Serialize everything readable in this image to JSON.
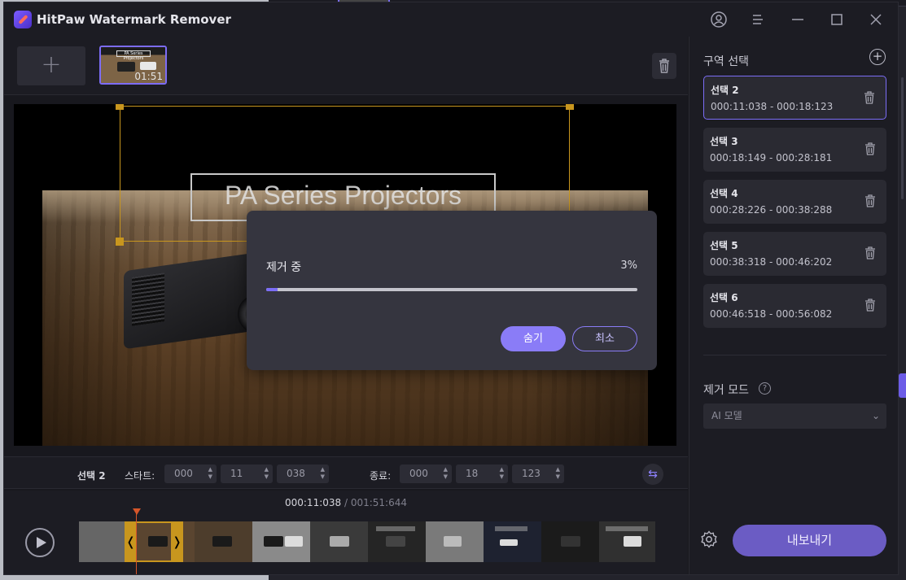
{
  "app": {
    "title": "HitPaw Watermark Remover"
  },
  "toolbar": {
    "add_label": "+",
    "thumbnail_duration": "01:51",
    "thumbnail_caption": "PA Series Projectors"
  },
  "video": {
    "watermark_text": "PA Series Projectors"
  },
  "dialog": {
    "label": "제거 중",
    "percent_text": "3%",
    "progress": 0.03,
    "hide_label": "숨기",
    "cancel_label": "최소"
  },
  "timebar": {
    "selection_name": "선택 2",
    "start_label": "스타트:",
    "start": [
      "000",
      "11",
      "038"
    ],
    "end_label": "종료:",
    "end": [
      "000",
      "18",
      "123"
    ]
  },
  "playback": {
    "current_time": "000:11:038",
    "separator": " / ",
    "total_time": "001:51:644"
  },
  "sidepanel": {
    "title": "구역 선택",
    "regions": [
      {
        "name": "선택 2",
        "time": "000:11:038 - 000:18:123"
      },
      {
        "name": "선택 3",
        "time": "000:18:149 - 000:28:181"
      },
      {
        "name": "선택 4",
        "time": "000:28:226 - 000:38:288"
      },
      {
        "name": "선택 5",
        "time": "000:38:318 - 000:46:202"
      },
      {
        "name": "선택 6",
        "time": "000:46:518 - 000:56:082"
      }
    ],
    "mode_label": "제거 모드",
    "mode_value": "AI 모델",
    "export_label": "내보내기"
  },
  "icons": [
    "app-logo-icon",
    "account-icon",
    "menu-icon",
    "minimize-icon",
    "maximize-icon",
    "close-icon",
    "trash-icon",
    "plus-circle-icon",
    "help-icon",
    "chevron-down-icon",
    "settings-icon",
    "play-icon",
    "swap-icon"
  ],
  "colors": {
    "accent": "#7b6df6",
    "selection": "#c8961e",
    "export": "#6b5cc4"
  }
}
